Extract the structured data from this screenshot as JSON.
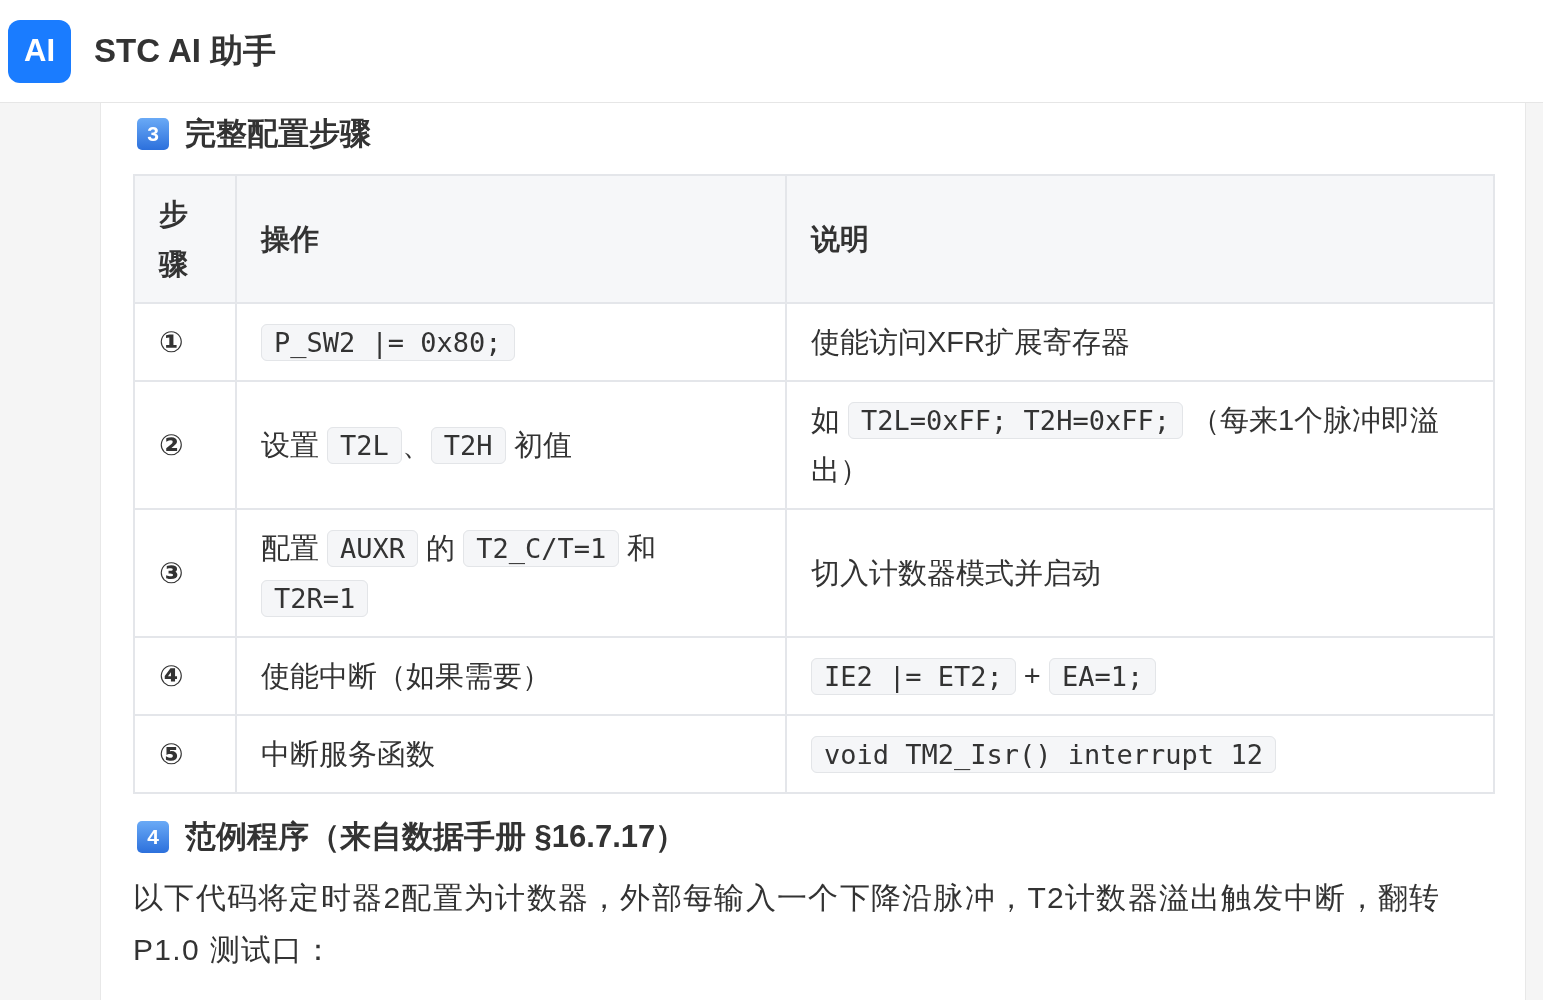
{
  "header": {
    "logo": "AI",
    "title": "STC AI 助手"
  },
  "content": [
    {
      "kind": "heading",
      "badge": "3",
      "text": "完整配置步骤"
    },
    {
      "kind": "table",
      "columns": [
        "步骤",
        "操作",
        "说明"
      ],
      "rows": [
        {
          "step": "①",
          "operation": [
            {
              "kind": "code",
              "text": "P_SW2 |= 0x80;"
            }
          ],
          "description": [
            {
              "kind": "text",
              "text": "使能访问XFR扩展寄存器"
            }
          ]
        },
        {
          "step": "②",
          "operation": [
            {
              "kind": "text",
              "text": "设置 "
            },
            {
              "kind": "code",
              "text": "T2L"
            },
            {
              "kind": "text",
              "text": "、"
            },
            {
              "kind": "code",
              "text": "T2H"
            },
            {
              "kind": "text",
              "text": " 初值"
            }
          ],
          "description": [
            {
              "kind": "text",
              "text": "如 "
            },
            {
              "kind": "code",
              "text": "T2L=0xFF; T2H=0xFF;"
            },
            {
              "kind": "text",
              "text": " （每来1个脉冲即溢"
            },
            {
              "kind": "text",
              "text": "出）"
            }
          ]
        },
        {
          "step": "③",
          "operation": [
            {
              "kind": "text",
              "text": "配置 "
            },
            {
              "kind": "code",
              "text": "AUXR"
            },
            {
              "kind": "text",
              "text": " 的 "
            },
            {
              "kind": "code",
              "text": "T2_C/T=1"
            },
            {
              "kind": "text",
              "text": " 和 "
            },
            {
              "kind": "code",
              "text": "T2R=1"
            }
          ],
          "description": [
            {
              "kind": "text",
              "text": "切入计数器模式并启动"
            }
          ]
        },
        {
          "step": "④",
          "operation": [
            {
              "kind": "text",
              "text": "使能中断（如果需要）"
            }
          ],
          "description": [
            {
              "kind": "code",
              "text": "IE2 |= ET2;"
            },
            {
              "kind": "text",
              "text": " + "
            },
            {
              "kind": "code",
              "text": "EA=1;"
            }
          ]
        },
        {
          "step": "⑤",
          "operation": [
            {
              "kind": "text",
              "text": "中断服务函数"
            }
          ],
          "description": [
            {
              "kind": "code",
              "text": "void TM2_Isr() interrupt 12"
            }
          ]
        }
      ]
    },
    {
      "kind": "heading",
      "badge": "4",
      "text": "范例程序（来自数据手册 §16.7.17）"
    },
    {
      "kind": "paragraph",
      "text": "以下代码将定时器2配置为计数器，外部每输入一个下降沿脉冲，T2计数器溢出触发中断，翻转 P1.0 测试口："
    }
  ]
}
